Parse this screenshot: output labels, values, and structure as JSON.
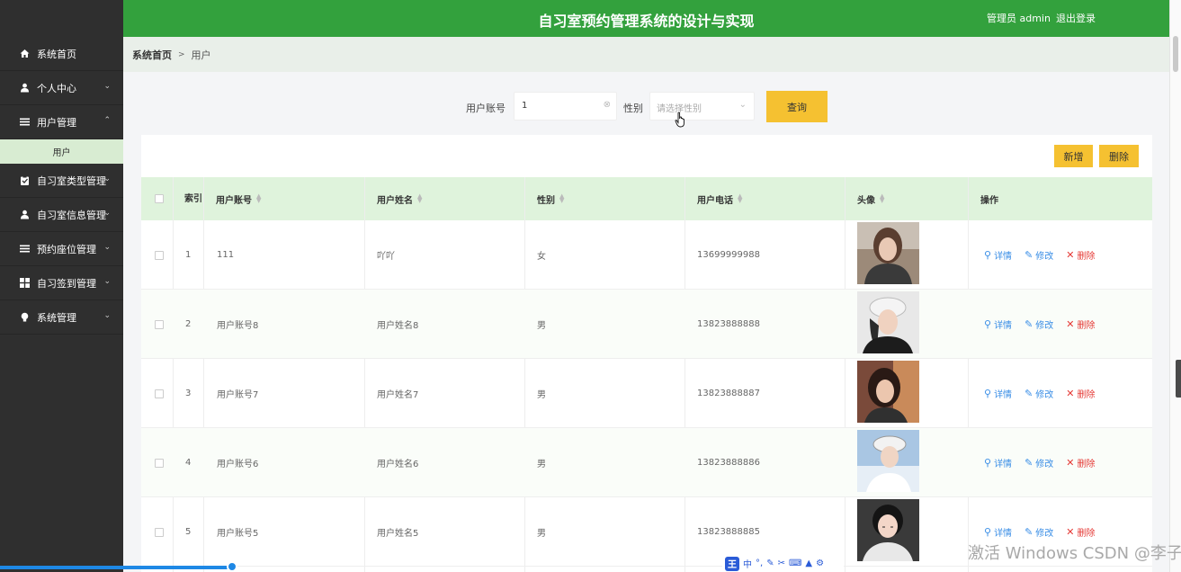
{
  "header": {
    "title": "自习室预约管理系统的设计与实现",
    "user_label": "管理员 admin",
    "logout": "退出登录"
  },
  "sidebar": {
    "items": [
      {
        "label": "系统首页",
        "icon": "home-icon"
      },
      {
        "label": "个人中心",
        "icon": "person-icon"
      },
      {
        "label": "用户管理",
        "icon": "list-icon"
      },
      {
        "label": "自习室类型管理",
        "icon": "clipboard-icon"
      },
      {
        "label": "自习室信息管理",
        "icon": "person-icon"
      },
      {
        "label": "预约座位管理",
        "icon": "list-icon"
      },
      {
        "label": "自习签到管理",
        "icon": "grid-icon"
      },
      {
        "label": "系统管理",
        "icon": "bulb-icon"
      }
    ],
    "sub_item": "用户"
  },
  "breadcrumb": {
    "home": "系统首页",
    "separator": ">",
    "current": "用户"
  },
  "search": {
    "account_label": "用户账号",
    "account_value": "1",
    "gender_label": "性别",
    "gender_placeholder": "请选择性别",
    "query_button": "查询"
  },
  "actions": {
    "add": "新增",
    "delete": "删除"
  },
  "table": {
    "headers": {
      "index": "索引",
      "account": "用户账号",
      "name": "用户姓名",
      "gender": "性别",
      "phone": "用户电话",
      "avatar": "头像",
      "ops": "操作"
    },
    "ops": {
      "detail": "详情",
      "edit": "修改",
      "del": "删除"
    },
    "rows": [
      {
        "index": "1",
        "account": "111",
        "name": "吖吖",
        "gender": "女",
        "phone": "13699999988"
      },
      {
        "index": "2",
        "account": "用户账号8",
        "name": "用户姓名8",
        "gender": "男",
        "phone": "13823888888"
      },
      {
        "index": "3",
        "account": "用户账号7",
        "name": "用户姓名7",
        "gender": "男",
        "phone": "13823888887"
      },
      {
        "index": "4",
        "account": "用户账号6",
        "name": "用户姓名6",
        "gender": "男",
        "phone": "13823888886"
      },
      {
        "index": "5",
        "account": "用户账号5",
        "name": "用户姓名5",
        "gender": "男",
        "phone": "13823888885"
      }
    ]
  },
  "overlay": {
    "ime_logo": "王",
    "ime_mode": "中",
    "watermark": "激活 Windows CSDN @李子c"
  }
}
